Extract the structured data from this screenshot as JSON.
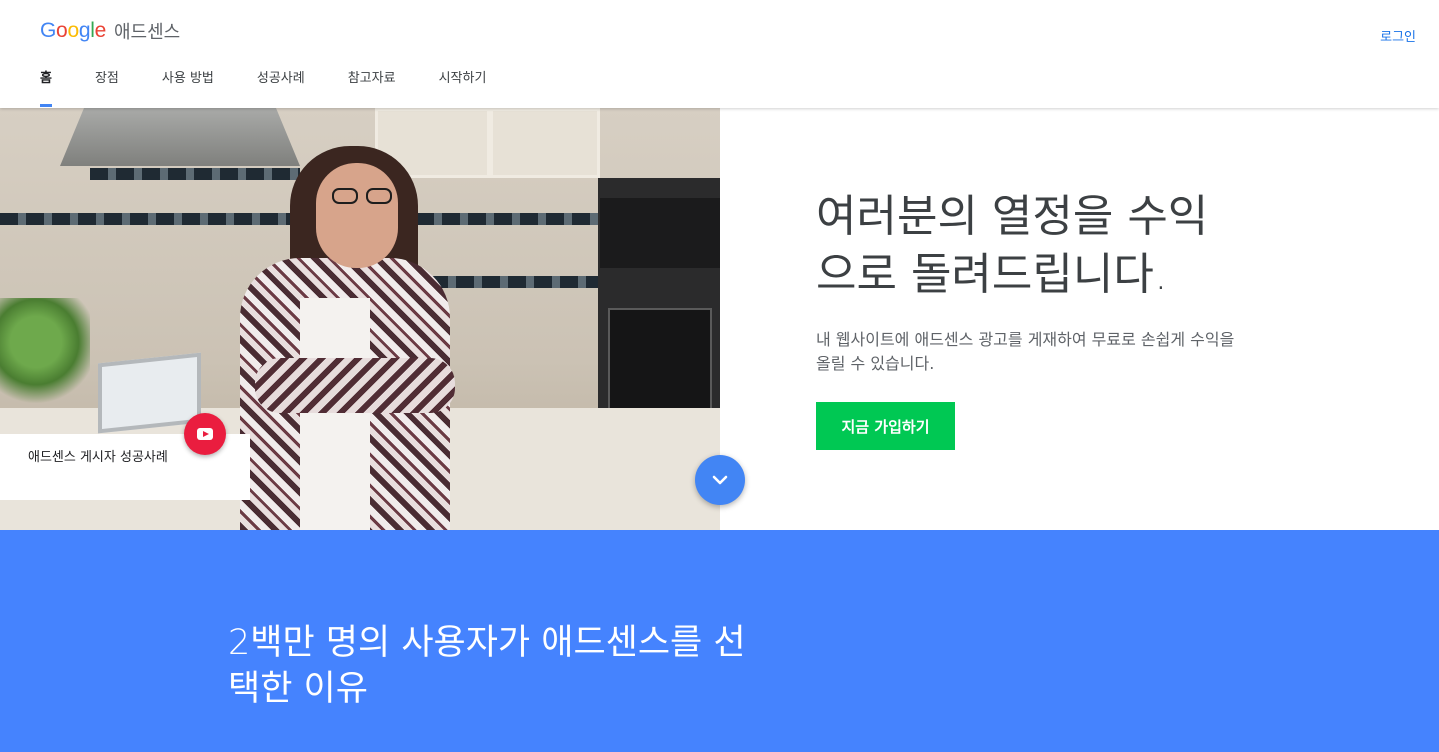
{
  "header": {
    "logo_google": "Google",
    "logo_product": "애드센스",
    "login_label": "로그인",
    "nav": [
      {
        "label": "홈",
        "active": true
      },
      {
        "label": "장점"
      },
      {
        "label": "사용 방법"
      },
      {
        "label": "성공사례"
      },
      {
        "label": "참고자료"
      },
      {
        "label": "시작하기"
      }
    ]
  },
  "hero": {
    "title": "여러분의 열정을 수익으로 돌려드립니다.",
    "subtitle": "내 웹사이트에 애드센스 광고를 게재하여 무료로 손쉽게 수익을 올릴 수 있습니다.",
    "cta_label": "지금 가입하기",
    "story_card_label": "애드센스 게시자 성공사례"
  },
  "section2": {
    "title": "2백만 명의 사용자가 애드센스를 선택한 이유"
  },
  "colors": {
    "google_blue": "#4285f4",
    "google_red": "#ea4335",
    "google_yellow": "#fbbc05",
    "google_green": "#34a853",
    "cta_green": "#00c853",
    "section_blue": "#4583fe",
    "play_red": "#ea1d3f"
  },
  "icons": [
    "youtube-play-icon",
    "chevron-down-icon"
  ]
}
